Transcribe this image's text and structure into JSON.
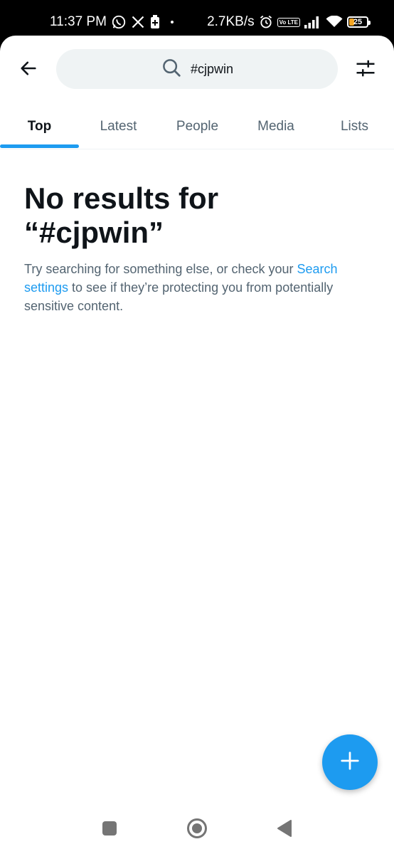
{
  "status_bar": {
    "time": "11:37 PM",
    "network_speed": "2.7KB/s",
    "volte": "Vo LTE",
    "battery_level": "25",
    "battery_fraction": 0.25,
    "icons": [
      "whatsapp-icon",
      "x-icon",
      "battery-saver-icon",
      "alarm-icon",
      "signal-icon",
      "wifi-icon"
    ]
  },
  "header": {
    "back_icon": "arrow-left-icon",
    "search_query": "#cjpwin",
    "search_icon": "search-icon",
    "filter_icon": "sliders-icon"
  },
  "tabs": [
    {
      "label": "Top",
      "active": true
    },
    {
      "label": "Latest",
      "active": false
    },
    {
      "label": "People",
      "active": false
    },
    {
      "label": "Media",
      "active": false
    },
    {
      "label": "Lists",
      "active": false
    }
  ],
  "empty_state": {
    "title_line1": "No results for",
    "title_line2": "“#cjpwin”",
    "text_before": "Try searching for something else, or check your ",
    "link_line1": "Search",
    "link_line2": "settings",
    "text_after": " to see if they’re protecting you from potentially sensitive content."
  },
  "fab": {
    "icon": "plus-icon"
  },
  "nav_bar": {
    "icons": [
      "recents-square-icon",
      "home-circle-icon",
      "back-triangle-icon"
    ]
  },
  "colors": {
    "accent": "#1d9bf0",
    "text_primary": "#0f1419",
    "text_secondary": "#536471",
    "search_bg": "#eff3f4"
  }
}
